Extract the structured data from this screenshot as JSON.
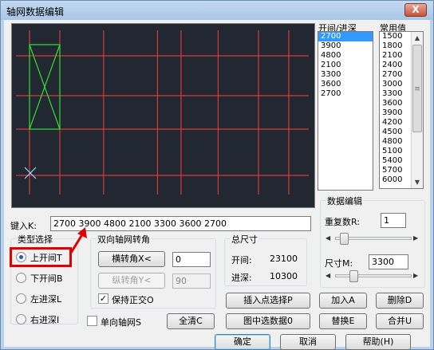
{
  "window": {
    "title": "轴网数据编辑",
    "close_label": "X"
  },
  "canvas": {
    "background": "#222831",
    "grid_color": "#ff3b3b",
    "selection_color": "#33dd33",
    "ucs_color": "#9fd8ff"
  },
  "spans": {
    "header": "开间/进深",
    "items": [
      "2700",
      "3900",
      "4800",
      "2100",
      "3300",
      "3600",
      "2700"
    ],
    "selected_index": 0
  },
  "common_values": {
    "header": "常用值",
    "items": [
      "1500",
      "1800",
      "2100",
      "2400",
      "2700",
      "3000",
      "3300",
      "3600",
      "3900",
      "4200",
      "4500",
      "4800",
      "5100",
      "5400",
      "5700",
      "6000"
    ]
  },
  "data_edit": {
    "title": "数据编辑",
    "repeat_label": "重复数R:",
    "repeat_value": "1",
    "size_label": "尺寸M:",
    "size_value": "3300"
  },
  "keyin": {
    "label": "键入K:",
    "value": "2700  3900  4800  2100  3300  3600  2700"
  },
  "type_select": {
    "title": "类型选择",
    "options": [
      "上开间T",
      "下开间B",
      "左进深L",
      "右进深I"
    ],
    "selected_index": 0
  },
  "rotation": {
    "title": "双向轴网转角",
    "horizontal_btn": "横转角X<",
    "horizontal_value": "0",
    "vertical_btn": "纵转角Y<",
    "vertical_value": "90",
    "orthogonal_label": "保持正交O",
    "orthogonal_checked": "✓"
  },
  "total": {
    "title": "总尺寸",
    "bay_label": "开间:",
    "bay_value": "23100",
    "depth_label": "进深:",
    "depth_value": "10300"
  },
  "single_axis": {
    "label": "单向轴网S"
  },
  "buttons": {
    "insert_select": "插入点选择P",
    "add": "加入A",
    "delete": "删除D",
    "clear": "全清C",
    "pick_data": "图中选数据0",
    "replace": "替换E",
    "merge": "合并U",
    "ok": "确定",
    "cancel": "取消",
    "help": "帮助(H)"
  },
  "highlight_color": "#e00000"
}
